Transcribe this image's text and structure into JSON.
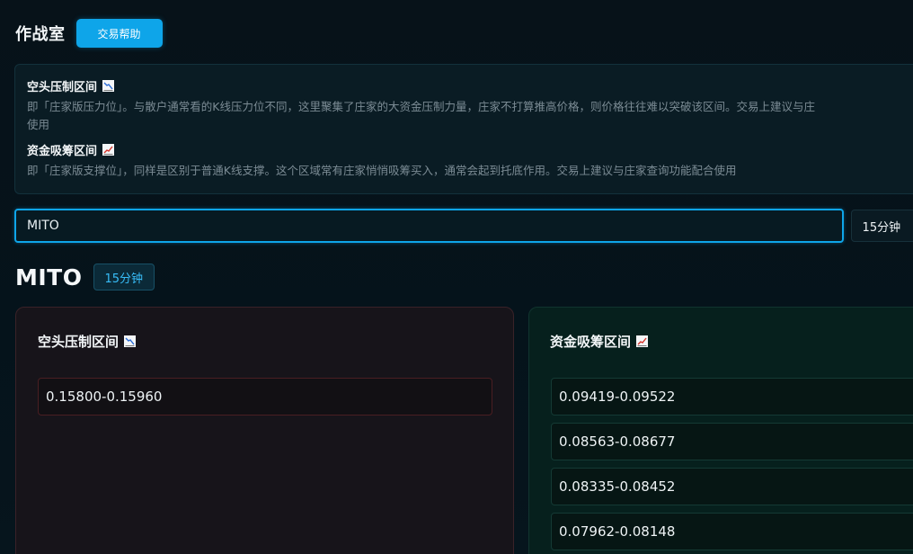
{
  "header": {
    "title": "作战室",
    "help_button": "交易帮助"
  },
  "info": {
    "short_zone": {
      "title": "空头压制区间",
      "icon": "chart-decreasing-icon",
      "desc_line1": "即「庄家版压力位」。与散户通常看的K线压力位不同，这里聚集了庄家的大资金压制力量，庄家不打算推高价格，则价格往往难以突破该区间。交易上建议与庄",
      "desc_line2": "使用"
    },
    "long_zone": {
      "title": "资金吸筹区间",
      "icon": "chart-increasing-icon",
      "desc": "即「庄家版支撑位」，同样是区别于普通K线支撑。这个区域常有庄家悄悄吸筹买入，通常会起到托底作用。交易上建议与庄家查询功能配合使用"
    }
  },
  "search": {
    "value": "MITO",
    "interval": "15分钟"
  },
  "result": {
    "symbol": "MITO",
    "interval": "15分钟",
    "short_card": {
      "title": "空头压制区间",
      "zones": [
        "0.15800-0.15960"
      ]
    },
    "long_card": {
      "title": "资金吸筹区间",
      "zones": [
        "0.09419-0.09522",
        "0.08563-0.08677",
        "0.08335-0.08452",
        "0.07962-0.08148"
      ]
    }
  },
  "colors": {
    "accent": "#0ea5e9",
    "short_border": "#4a1e22",
    "long_border": "#143a34"
  }
}
